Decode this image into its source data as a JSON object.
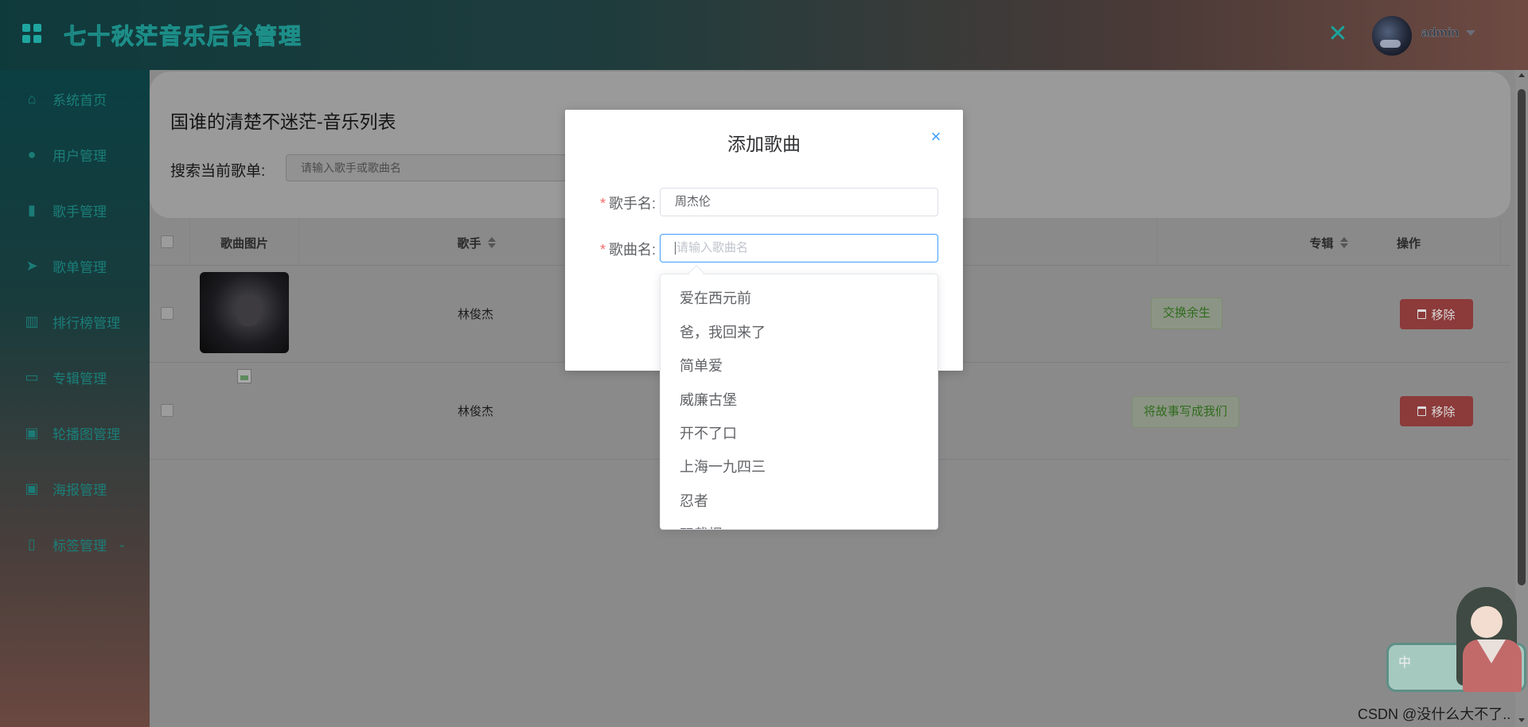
{
  "header": {
    "app_title": "七十秋茫音乐后台管理",
    "user_name": "admin",
    "icons": [
      "grid-icon",
      "fullscreen-icon",
      "caret-down-icon"
    ]
  },
  "sidebar": {
    "items": [
      {
        "label": "系统首页",
        "icon": "home-icon"
      },
      {
        "label": "用户管理",
        "icon": "user-icon"
      },
      {
        "label": "歌手管理",
        "icon": "microphone-icon"
      },
      {
        "label": "歌单管理",
        "icon": "paper-plane-icon"
      },
      {
        "label": "排行榜管理",
        "icon": "bar-chart-icon"
      },
      {
        "label": "专辑管理",
        "icon": "box-icon"
      },
      {
        "label": "轮播图管理",
        "icon": "image-icon"
      },
      {
        "label": "海报管理",
        "icon": "image-icon"
      },
      {
        "label": "标签管理",
        "icon": "bookmark-icon"
      }
    ]
  },
  "page": {
    "list_title": "国谁的清楚不迷茫-音乐列表",
    "search_label": "搜索当前歌单:",
    "search_placeholder": "请输入歌手或歌曲名"
  },
  "table": {
    "headers": {
      "pic": "歌曲图片",
      "singer": "歌手",
      "album": "专辑",
      "action": "操作"
    },
    "rows": [
      {
        "singer": "林俊杰",
        "album": "交换余生",
        "action": "移除"
      },
      {
        "singer": "林俊杰",
        "album": "将故事写成我们",
        "action": "移除"
      }
    ]
  },
  "dialog": {
    "title": "添加歌曲",
    "singer_label": "歌手名:",
    "singer_value": "周杰伦",
    "song_label": "歌曲名:",
    "song_placeholder": "请输入歌曲名"
  },
  "autocomplete": {
    "items": [
      "爱在西元前",
      "爸，我回来了",
      "简单爱",
      "威廉古堡",
      "开不了口",
      "上海一九四三",
      "忍者",
      "双截棍"
    ]
  },
  "widget": {
    "badge_text": "中"
  },
  "watermark": "CSDN @没什么大不了..",
  "colors": {
    "accent": "#409eff",
    "danger": "#f56c6c",
    "sidebar_text": "#1a7e79"
  }
}
